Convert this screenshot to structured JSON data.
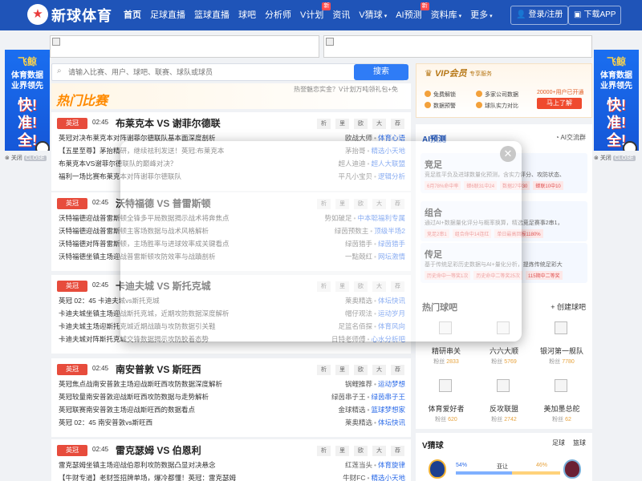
{
  "header": {
    "logo_glyph": "★",
    "brand": "新球体育",
    "nav": [
      {
        "label": "首页",
        "active": true
      },
      {
        "label": "足球直播"
      },
      {
        "label": "篮球直播"
      },
      {
        "label": "球吧"
      },
      {
        "label": "分析师"
      },
      {
        "label": "V计划",
        "badge": "新"
      },
      {
        "label": "资讯"
      },
      {
        "label": "V猜球",
        "caret": "▾"
      },
      {
        "label": "AI预测",
        "badge": "新"
      },
      {
        "label": "资料库",
        "caret": "▾"
      },
      {
        "label": "更多",
        "caret": "▾"
      }
    ],
    "login_label": "登录/注册",
    "download_label": "下载APP"
  },
  "side_ads": {
    "line1": "飞鲸",
    "line2": "体育数据",
    "line3": "业界领先",
    "line4": "快!",
    "line5": "准!",
    "line6": "全!",
    "close": "关闭",
    "close_tag": "CLOSE"
  },
  "search": {
    "placeholder": "请输入比赛、用户、球吧、联赛、球队或球员",
    "button": "搜索"
  },
  "hot": {
    "title": "热门比赛",
    "marquee": "热誉魅恋实金？V计划万吨领礼包+免"
  },
  "chips": [
    "析",
    "里",
    "欧",
    "大",
    "荐"
  ],
  "matches": [
    {
      "league": "英冠",
      "time": "02:45",
      "title": "布莱克本 VS 谢菲尔德联",
      "articles": [
        {
          "text": "英冠对决布莱克本对阵谢菲尔德联队基本面深度剖析",
          "author": "欧战大师",
          "source": "体育心语"
        },
        {
          "text": "【五星至尊】茅抬精研，继续祛利发送！英冠:布莱克本",
          "author": "茅抬哥",
          "source": "精选小天地"
        },
        {
          "text": "布莱克本VS谢菲尔德联队的巅峰对决？",
          "author": "超人迪迪",
          "source": "超人大联盟"
        },
        {
          "text": "福利一场比赛布莱克本对阵谢菲尔德联队",
          "author": "平凡小宝贝",
          "source": "逻辑分析"
        }
      ]
    },
    {
      "league": "英冠",
      "time": "02:45",
      "title": "沃特福德 VS 普雷斯顿",
      "articles": [
        {
          "text": "沃特福德迎战普雷斯顿全锋多平局数据揭示战术将奔焦点",
          "author": "势如破足",
          "source": "中本聪福利专属"
        },
        {
          "text": "沃特福德迎战普雷斯顿主客场数据与战术风格解析",
          "author": "绿茵预数主",
          "source": "顶级半场2"
        },
        {
          "text": "沃特福德对阵普雷斯顿，主场胜率与进球效率成关键看点",
          "author": "绿茵猎手",
          "source": "绿茵猎手"
        },
        {
          "text": "沃特福德坐镇主场迎战普雷斯顿攻防效率与战蹟剖析",
          "author": "一點兢红",
          "source": "网坛激情"
        }
      ]
    },
    {
      "league": "英冠",
      "time": "02:45",
      "title": "卡迪夫城 VS 斯托克城",
      "articles": [
        {
          "text": "英冠 02：45 卡迪夫城vs斯托克城",
          "author": "莱奥精选",
          "source": "体坛快讯"
        },
        {
          "text": "卡迪夫城坐镇主场迎战斯托克城，近期攻防数据深度解析",
          "author": "帽仔观法",
          "source": "运动岁月"
        },
        {
          "text": "卡迪夫城主场迎斯托克城近期战蹟与攻防数据引关鞋",
          "author": "足篮名佰探",
          "source": "体育风向"
        },
        {
          "text": "卡迪夫城对阵斯托克城交锋数据揭示攻防胶着态势",
          "author": "日特老师傅",
          "source": "心水分析吧"
        }
      ]
    },
    {
      "league": "英冠",
      "time": "02:45",
      "title": "南安普敦 VS 斯旺西",
      "articles": [
        {
          "text": "英冠焦点战南安普敦主场迎战斯旺西攻防数据深度解析",
          "author": "锅鲤推荐",
          "source": "运动梦想"
        },
        {
          "text": "英冠较量南安普敦迎战斯旺西攻防数据与走势解析",
          "author": "绿茵串子王",
          "source": "绿茵串子王"
        },
        {
          "text": "英冠联赛南安普敦主场迎战斯旺西的数据看点",
          "author": "金球精选",
          "source": "篮球梦想家"
        },
        {
          "text": "英冠 02：45 南安普敦vs斯旺西",
          "author": "莱奥精选",
          "source": "体坛快讯"
        }
      ]
    },
    {
      "league": "英冠",
      "time": "02:45",
      "title": "雷克瑟姆 VS 伯恩利",
      "articles": [
        {
          "text": "雷克瑟姆坐镇主场迎战伯恩利攻防数据凸显对决悬念",
          "author": "红莲当头",
          "source": "体育旋律"
        },
        {
          "text": "【牛财专道】老财签招牌单场，爆冷都懂！英冠：雷克瑟姆",
          "author": "牛财FC",
          "source": "精选小天地"
        }
      ]
    }
  ],
  "vip": {
    "title": "VIP会员",
    "subtitle": "专享服务",
    "features": [
      "免费解锁",
      "多家公司数据",
      "数据预警",
      "球队实力对比"
    ],
    "promo": "20000+用户已开通",
    "button": "马上了解"
  },
  "ai": {
    "title": "AI预测",
    "link": "AI交流群",
    "blocks": [
      {
        "name": "竞足",
        "desc": "竞足胜平负及进球数量化预测，含实力评分、攻防状态、",
        "tags": [
          "6月78%命中率",
          "蝉6联31中24",
          "数据27中30",
          "蝉联10中10"
        ]
      },
      {
        "name": "组合",
        "desc": "通过AI+数据量化评分与概率换算，精选竞足赛事2串1，",
        "tags": [
          "竞足2串1",
          "组合命中14连红",
          "单日最高回报1180%"
        ]
      },
      {
        "name": "传足",
        "desc": "基于传统足彩历史数据与AI+量化分析，提炼传统足彩大",
        "tags": [
          "历史命中一等奖1次",
          "历史命中二等奖25次",
          "115期中二等奖"
        ]
      }
    ]
  },
  "hot_bar": {
    "title": "热门球吧",
    "create": "+ 创建球吧",
    "items": [
      {
        "name": "精研串关",
        "fans_label": "粉丝",
        "fans": "2833"
      },
      {
        "name": "六六大顺",
        "fans_label": "粉丝",
        "fans": "5769"
      },
      {
        "name": "银河第一舰队",
        "fans_label": "粉丝",
        "fans": "7780"
      },
      {
        "name": "体育爱好者",
        "fans_label": "粉丝",
        "fans": "620"
      },
      {
        "name": "反攻联盟",
        "fans_label": "粉丝",
        "fans": "2742"
      },
      {
        "name": "美加墨总舵",
        "fans_label": "粉丝",
        "fans": "62"
      }
    ]
  },
  "vguess": {
    "title": "V猜球",
    "tabs": [
      "足球",
      "篮球"
    ],
    "left_pct": "54%",
    "mid": "亚让",
    "right_pct": "46%",
    "left_pct_num": 54,
    "right_pct_num": 46
  },
  "popup": {
    "close_glyph": "✕"
  },
  "colors": {
    "header": "#1f54b8",
    "league_badge": "#e74c3c",
    "accent": "#2f7cf6"
  }
}
